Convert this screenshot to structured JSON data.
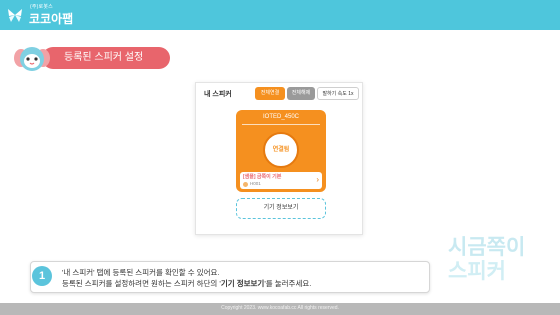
{
  "brand": {
    "subtitle": "(주)로봇스",
    "title": "코코아팹"
  },
  "section": {
    "title": "등록된 스피커 설정"
  },
  "phone": {
    "title": "내 스피커",
    "chips": {
      "connect_all": "전체연결",
      "disconnect_all": "전체해제",
      "speed": "말하기 속도 1x"
    },
    "speaker_card": {
      "device_id": "IOTED_450C",
      "status": "연결됨",
      "lesson_title": "[샘플] 금쪽이 기본",
      "lesson_code": "H001"
    },
    "info_button": "기기 정보보기"
  },
  "guide": {
    "step": "1",
    "line1": "'내 스피커' 탭에 등록된 스피커를 확인할 수 있어요.",
    "line2_prefix": "등록된 스피커를 설정하려면 원하는 스피커 하단의 '",
    "line2_bold": "기기 정보보기",
    "line2_suffix": "'를 눌러주세요."
  },
  "watermark": {
    "line1": "시금쪽이",
    "line2": "스피커"
  },
  "footer": {
    "copyright": "Copyright 2023. www.kocoafab.cc All rights reserved."
  },
  "colors": {
    "header": "#4ec6dc",
    "pill": "#e8656c",
    "card": "#f5901f",
    "step": "#5bc4dc"
  },
  "icons": [
    "butterfly-logo-icon",
    "elephant-mascot-icon",
    "chevron-right-icon"
  ]
}
